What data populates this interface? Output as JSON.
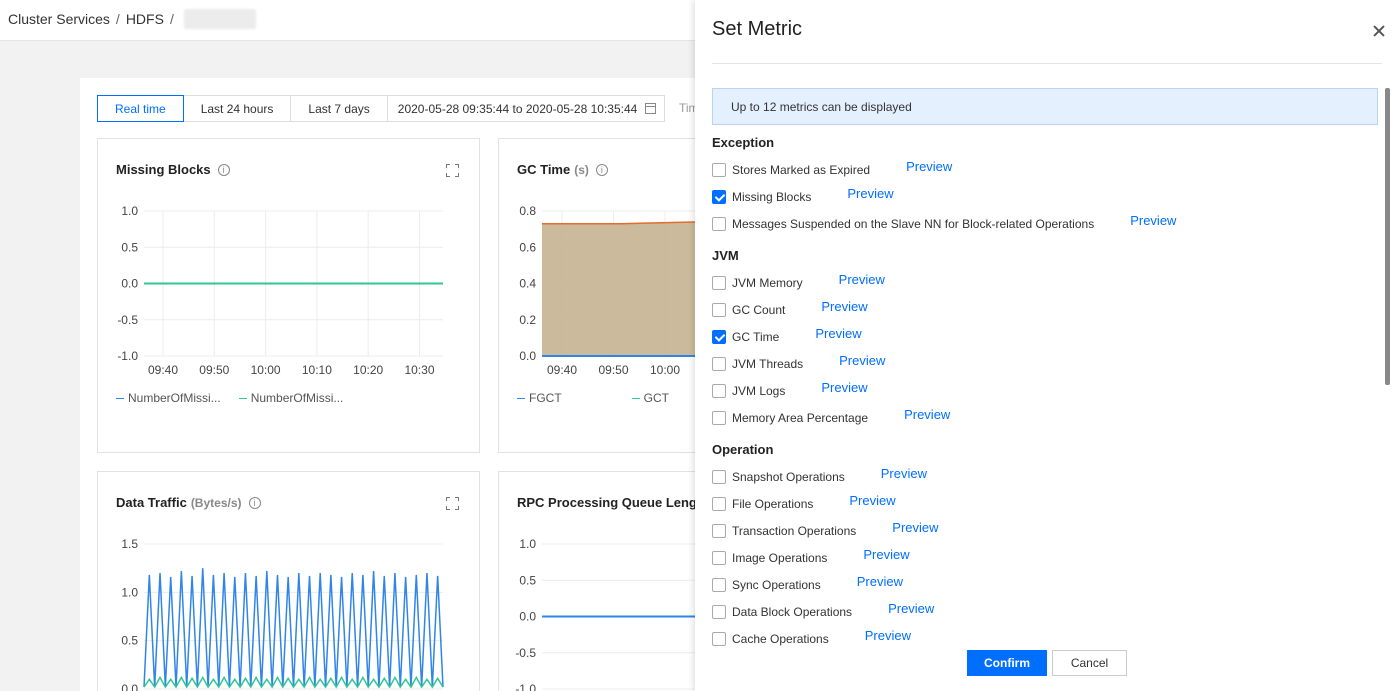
{
  "breadcrumb": {
    "items": [
      "Cluster Services",
      "HDFS"
    ]
  },
  "toolbar": {
    "ranges": [
      "Real time",
      "Last 24 hours",
      "Last 7 days"
    ],
    "active_range": "Real time",
    "date_range": "2020-05-28 09:35:44 to 2020-05-28 10:35:44",
    "truncated_label": "Tim"
  },
  "cards": {
    "missing_blocks": {
      "title": "Missing Blocks",
      "legend": [
        "NumberOfMissi...",
        "NumberOfMissi..."
      ]
    },
    "gc_time": {
      "title": "GC Time",
      "unit": "(s)",
      "legend": [
        "FGCT",
        "GCT"
      ]
    },
    "data_traffic": {
      "title": "Data Traffic",
      "unit": "(Bytes/s)"
    },
    "rpc_queue": {
      "title": "RPC Processing Queue Lengt"
    }
  },
  "chart_data": [
    {
      "type": "line",
      "title": "Missing Blocks",
      "x": [
        "09:40",
        "09:50",
        "10:00",
        "10:10",
        "10:20",
        "10:30"
      ],
      "ylim": [
        -1.0,
        1.0
      ],
      "yticks": [
        "1.0",
        "0.5",
        "0.0",
        "-0.5",
        "-1.0"
      ],
      "series": [
        {
          "name": "NumberOfMissi...",
          "values": [
            0,
            0,
            0,
            0,
            0,
            0
          ]
        },
        {
          "name": "NumberOfMissi...",
          "values": [
            0,
            0,
            0,
            0,
            0,
            0
          ]
        }
      ],
      "grid": true,
      "legend": "bottom"
    },
    {
      "type": "area",
      "title": "GC Time",
      "ylabel": "(s)",
      "x": [
        "09:40",
        "09:50",
        "10:00"
      ],
      "ylim": [
        0,
        0.8
      ],
      "yticks": [
        "0.8",
        "0.6",
        "0.4",
        "0.2",
        "0.0"
      ],
      "series": [
        {
          "name": "FGCT",
          "values": [
            0,
            0,
            0
          ]
        },
        {
          "name": "GCT",
          "values": [
            0.73,
            0.73,
            0.74
          ]
        }
      ],
      "grid": true,
      "legend": "bottom"
    },
    {
      "type": "line",
      "title": "Data Traffic",
      "ylabel": "(Bytes/s)",
      "ylim": [
        0,
        1.5
      ],
      "yticks": [
        "1.5",
        "1.0",
        "0.5",
        "0.0"
      ],
      "series": [
        {
          "values": [
            1.18,
            1.2,
            1.16,
            1.22,
            1.17,
            1.25,
            1.18,
            1.2,
            1.16,
            1.2,
            1.17,
            1.22,
            1.18,
            1.16,
            1.2,
            1.17,
            1.2,
            1.18,
            1.16,
            1.2,
            1.18,
            1.22,
            1.17,
            1.2,
            1.16,
            1.18,
            1.2,
            1.17
          ]
        },
        {
          "values": [
            0.1,
            0.12,
            0.1,
            0.12,
            0.11,
            0.12,
            0.1,
            0.12,
            0.1,
            0.11,
            0.12,
            0.1,
            0.12,
            0.11,
            0.1,
            0.12,
            0.1,
            0.11,
            0.12,
            0.1,
            0.12,
            0.1,
            0.11,
            0.12,
            0.1,
            0.12,
            0.1,
            0.11
          ]
        }
      ],
      "grid": true
    },
    {
      "type": "line",
      "title": "RPC Processing Queue Lengt",
      "ylim": [
        -1.0,
        1.0
      ],
      "yticks": [
        "1.0",
        "0.5",
        "0.0",
        "-0.5",
        "-1.0"
      ],
      "series": [
        {
          "values": [
            0,
            0,
            0,
            0
          ]
        }
      ],
      "grid": true
    }
  ],
  "drawer": {
    "title": "Set Metric",
    "notice": "Up to 12 metrics can be displayed",
    "preview_label": "Preview",
    "groups": [
      {
        "title": "Exception",
        "items": [
          {
            "label": "Stores Marked as Expired",
            "checked": false
          },
          {
            "label": "Missing Blocks",
            "checked": true
          },
          {
            "label": "Messages Suspended on the Slave NN for Block-related Operations",
            "checked": false
          }
        ]
      },
      {
        "title": "JVM",
        "items": [
          {
            "label": "JVM Memory",
            "checked": false
          },
          {
            "label": "GC Count",
            "checked": false
          },
          {
            "label": "GC Time",
            "checked": true
          },
          {
            "label": "JVM Threads",
            "checked": false
          },
          {
            "label": "JVM Logs",
            "checked": false
          },
          {
            "label": "Memory Area Percentage",
            "checked": false
          }
        ]
      },
      {
        "title": "Operation",
        "items": [
          {
            "label": "Snapshot Operations",
            "checked": false
          },
          {
            "label": "File Operations",
            "checked": false
          },
          {
            "label": "Transaction Operations",
            "checked": false
          },
          {
            "label": "Image Operations",
            "checked": false
          },
          {
            "label": "Sync Operations",
            "checked": false
          },
          {
            "label": "Data Block Operations",
            "checked": false
          },
          {
            "label": "Cache Operations",
            "checked": false
          }
        ]
      }
    ],
    "confirm_label": "Confirm",
    "cancel_label": "Cancel"
  },
  "colors": {
    "accent": "#006eff",
    "series_green": "#2ec98e",
    "series_blue": "#2f86e8",
    "gc_fill": "#c8b797",
    "gc_line": "#e36b2c"
  }
}
